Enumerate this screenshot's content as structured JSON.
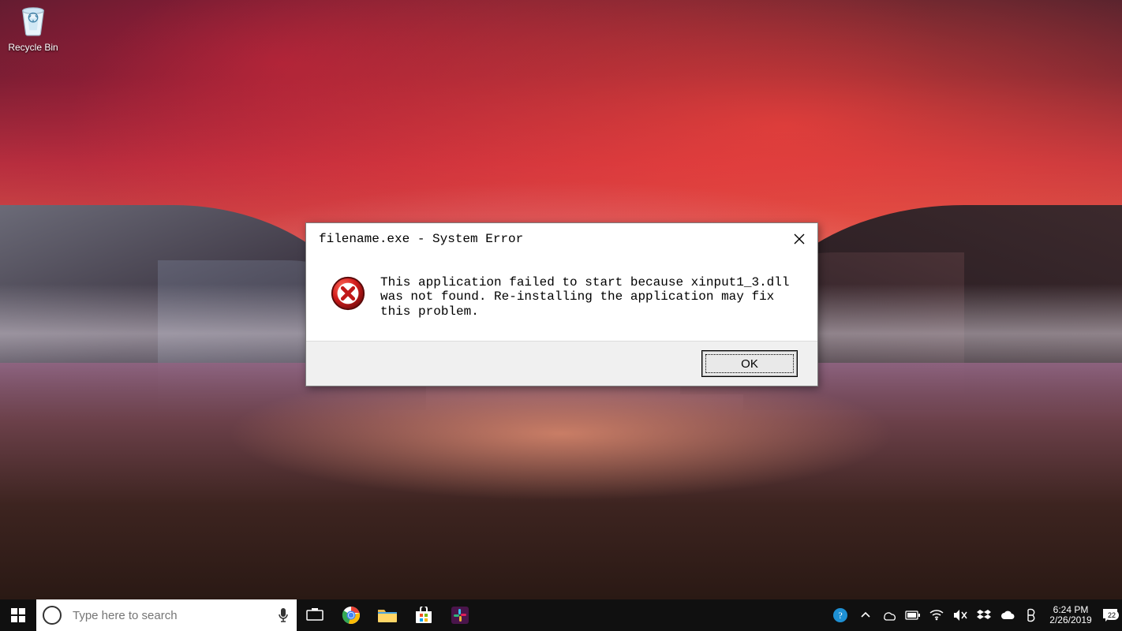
{
  "desktop": {
    "icons": [
      {
        "name": "recycle-bin",
        "label": "Recycle Bin"
      }
    ]
  },
  "dialog": {
    "title": "filename.exe - System Error",
    "message": "This application failed to start because xinput1_3.dll was not found. Re-installing the application may fix this problem.",
    "ok_label": "OK"
  },
  "taskbar": {
    "search_placeholder": "Type here to search",
    "pinned": [
      {
        "name": "task-view",
        "icon": "task-view-icon"
      },
      {
        "name": "chrome",
        "icon": "chrome-icon"
      },
      {
        "name": "file-explorer",
        "icon": "file-explorer-icon"
      },
      {
        "name": "ms-store",
        "icon": "store-icon"
      },
      {
        "name": "slack",
        "icon": "slack-icon"
      }
    ],
    "tray": [
      {
        "name": "get-help",
        "icon": "help-icon"
      },
      {
        "name": "tray-overflow",
        "icon": "chevron-up-icon"
      },
      {
        "name": "onedrive-sync",
        "icon": "sync-icon"
      },
      {
        "name": "battery",
        "icon": "battery-icon"
      },
      {
        "name": "wifi",
        "icon": "wifi-icon"
      },
      {
        "name": "volume-muted",
        "icon": "volume-mute-icon"
      },
      {
        "name": "dropbox",
        "icon": "dropbox-icon"
      },
      {
        "name": "cloud",
        "icon": "cloud-icon"
      },
      {
        "name": "bluetooth-dev",
        "icon": "device-icon"
      }
    ],
    "clock": {
      "time": "6:24 PM",
      "date": "2/26/2019"
    },
    "notification_count": "22"
  }
}
